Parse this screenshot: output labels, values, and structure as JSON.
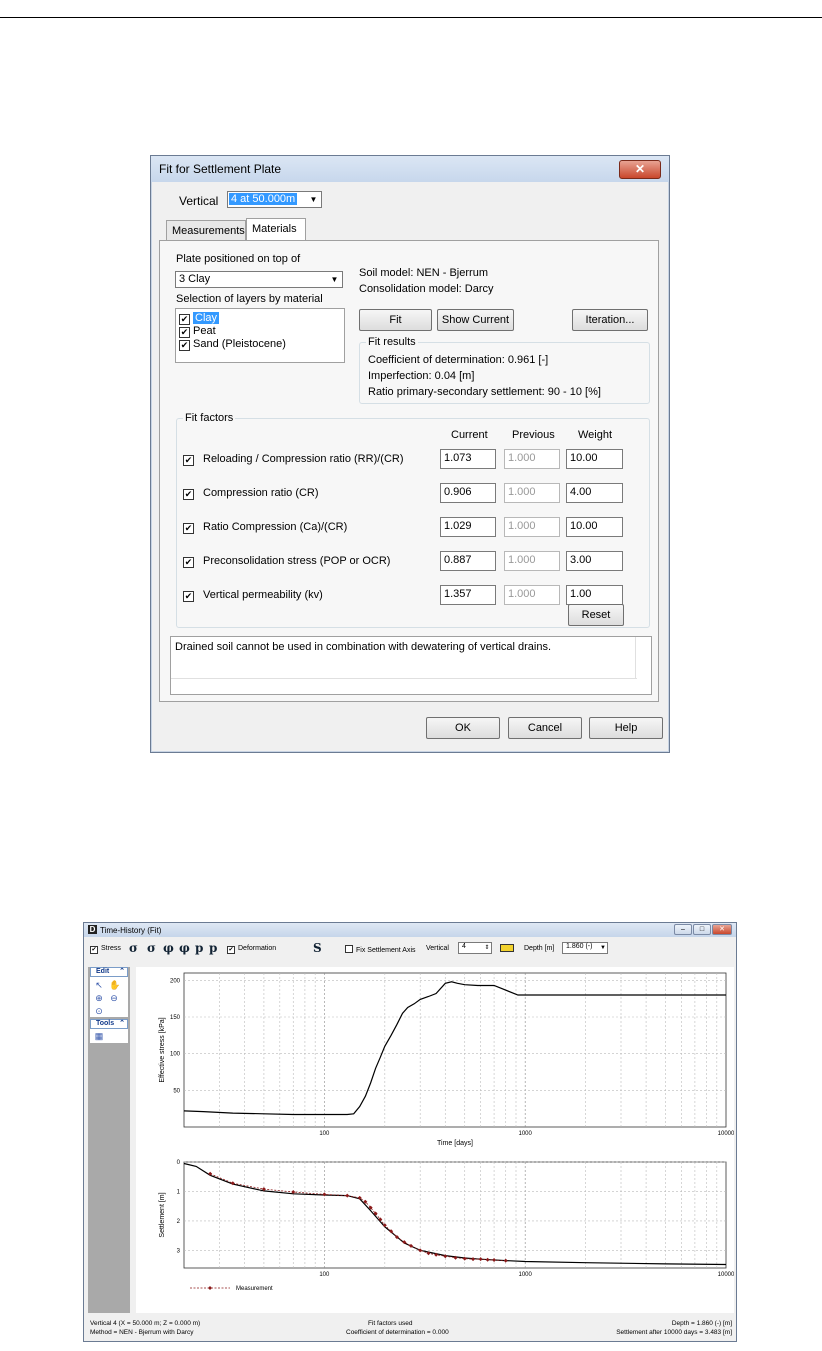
{
  "dialog": {
    "title": "Fit for Settlement Plate",
    "close_glyph": "✕",
    "vertical_label": "Vertical",
    "vertical_value": "4 at 50.000m",
    "tabs": [
      "Measurements",
      "Materials"
    ],
    "plate_label": "Plate positioned on top of",
    "plate_value": "3  Clay",
    "selection_label": "Selection of layers by material",
    "materials": [
      {
        "name": "Clay",
        "checked": true,
        "selected": true
      },
      {
        "name": "Peat",
        "checked": true,
        "selected": false
      },
      {
        "name": "Sand (Pleistocene)",
        "checked": true,
        "selected": false
      }
    ],
    "soil_model": "Soil model: NEN - Bjerrum",
    "consolidation_model": "Consolidation model: Darcy",
    "buttons": {
      "fit": "Fit",
      "show_current": "Show Current",
      "iteration": "Iteration...",
      "reset": "Reset",
      "ok": "OK",
      "cancel": "Cancel",
      "help": "Help"
    },
    "fit_results": {
      "title": "Fit results",
      "coefficient": "Coefficient of determination: 0.961 [-]",
      "imperfection": "Imperfection: 0.04 [m]",
      "ratio": "Ratio primary-secondary settlement: 90 - 10 [%]"
    },
    "fit_factors": {
      "title": "Fit factors",
      "col_current": "Current",
      "col_previous": "Previous",
      "col_weight": "Weight",
      "rows": [
        {
          "label": "Reloading / Compression ratio (RR)/(CR)",
          "current": "1.073",
          "previous": "1.000",
          "weight": "10.00"
        },
        {
          "label": "Compression ratio (CR)",
          "current": "0.906",
          "previous": "1.000",
          "weight": "4.00"
        },
        {
          "label": "Ratio Compression (Ca)/(CR)",
          "current": "1.029",
          "previous": "1.000",
          "weight": "10.00"
        },
        {
          "label": "Preconsolidation stress (POP or OCR)",
          "current": "0.887",
          "previous": "1.000",
          "weight": "3.00"
        },
        {
          "label": "Vertical permeability (kv)",
          "current": "1.357",
          "previous": "1.000",
          "weight": "1.00"
        }
      ]
    },
    "message": "Drained soil cannot be used in combination with dewatering of vertical drains."
  },
  "timehistory": {
    "title": "Time-History (Fit)",
    "toolbar": {
      "stress": "Stress",
      "deformation": "Deformation",
      "fix_axis": "Fix Settlement Axis",
      "vertical_label": "Vertical",
      "vertical_value": "4",
      "depth_label": "Depth [m]",
      "depth_value": "1.860 (-)",
      "symbols": [
        "σ",
        "σ",
        "φ",
        "φ",
        "p",
        "p",
        "S"
      ]
    },
    "side": {
      "edit": "Edit",
      "tools": "Tools"
    },
    "status": {
      "left1": "Vertical 4 (X = 50.000 m; Z = 0.000 m)",
      "left2": "Method = NEN - Bjerrum with Darcy",
      "mid1": "Fit factors used",
      "mid2": "Coefficient of determination = 0.000",
      "right1": "Depth = 1.860 (-) [m]",
      "right2": "Settlement after 10000 days = 3.483 [m]"
    }
  },
  "chart_data": [
    {
      "type": "line",
      "xlabel": "Time [days]",
      "ylabel": "Effective stress [kPa]",
      "xscale": "log",
      "xlim": [
        20,
        10000
      ],
      "ylim": [
        0,
        210
      ],
      "x_ticks": [
        "100",
        "1000",
        "10000"
      ],
      "y_ticks": [
        "50",
        "100",
        "150",
        "200"
      ],
      "grid": true,
      "series": [
        {
          "x": [
            20,
            25,
            35,
            50,
            70,
            100,
            130,
            140,
            150,
            160,
            170,
            180,
            190,
            200,
            215,
            230,
            245,
            260,
            280,
            300,
            330,
            360,
            400,
            430,
            460,
            500,
            580,
            700,
            920,
            10000
          ],
          "y": [
            22,
            21,
            19,
            18,
            17,
            17,
            17,
            18,
            28,
            42,
            60,
            80,
            95,
            110,
            125,
            140,
            155,
            163,
            168,
            174,
            178,
            182,
            196,
            198,
            196,
            194,
            193,
            193,
            180,
            180
          ]
        }
      ]
    },
    {
      "type": "line",
      "xlabel": "",
      "ylabel": "Settlement [m]",
      "xscale": "log",
      "xlim": [
        20,
        10000
      ],
      "ylim": [
        3.6,
        0
      ],
      "x_ticks": [
        "100",
        "1000",
        "10000"
      ],
      "y_ticks": [
        "0",
        "1",
        "2",
        "3"
      ],
      "grid": true,
      "legend": {
        "position": "bottom-left",
        "label": "Measurement"
      },
      "series": [
        {
          "x": [
            20,
            23,
            27,
            35,
            50,
            70,
            100,
            130,
            150,
            170,
            200,
            250,
            300,
            400,
            500,
            600,
            800,
            1000,
            2000,
            5000,
            10000
          ],
          "y": [
            0.05,
            0.15,
            0.45,
            0.75,
            0.98,
            1.08,
            1.12,
            1.14,
            1.25,
            1.65,
            2.2,
            2.75,
            3.0,
            3.18,
            3.26,
            3.3,
            3.35,
            3.38,
            3.42,
            3.46,
            3.48
          ]
        },
        {
          "name": "Measurement",
          "x": [
            27,
            35,
            50,
            70,
            100,
            130,
            150,
            160,
            170,
            180,
            190,
            200,
            215,
            230,
            250,
            270,
            300,
            330,
            360,
            400,
            450,
            500,
            550,
            600,
            650,
            700,
            800
          ],
          "y": [
            0.4,
            0.72,
            0.92,
            1.02,
            1.1,
            1.14,
            1.22,
            1.35,
            1.55,
            1.75,
            1.95,
            2.15,
            2.35,
            2.55,
            2.72,
            2.85,
            3.0,
            3.1,
            3.15,
            3.2,
            3.25,
            3.28,
            3.3,
            3.3,
            3.32,
            3.33,
            3.35
          ]
        }
      ]
    }
  ]
}
